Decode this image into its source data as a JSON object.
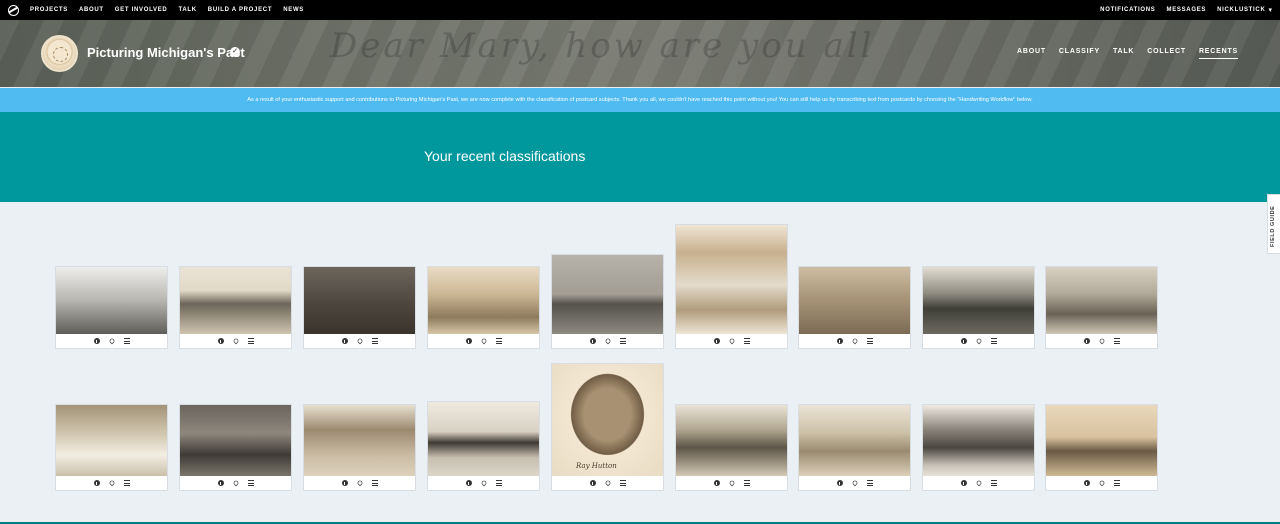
{
  "topnav": {
    "links": [
      "PROJECTS",
      "ABOUT",
      "GET INVOLVED",
      "TALK",
      "BUILD A PROJECT",
      "NEWS"
    ],
    "right": [
      "NOTIFICATIONS",
      "MESSAGES",
      "NICKLUSTICK"
    ]
  },
  "project": {
    "title": "Picturing Michigan's Past",
    "nav": [
      "ABOUT",
      "CLASSIFY",
      "TALK",
      "COLLECT",
      "RECENTS"
    ],
    "active_nav": "RECENTS"
  },
  "announcement": "As a result of your enthusiastic support and contributions to Picturing Michigan's Past, we are now complete with the classification of postcard subjects. Thank you all, we couldn't have reached this point without you! You can still help us by transcribing text from postcards by choosing the \"Handwriting Workflow\" below.",
  "page": {
    "heading": "Your recent classifications",
    "field_guide": "FIELD GUIDE"
  },
  "cards": {
    "row1": [
      {
        "subject": "portrait-group-porch",
        "style": "p-bw"
      },
      {
        "subject": "field-plow",
        "style": "p-field"
      },
      {
        "subject": "workers-dark",
        "style": "p-dark"
      },
      {
        "subject": "house-sepia",
        "style": "p-house"
      },
      {
        "subject": "lake-shore",
        "style": "p-lake"
      },
      {
        "subject": "large-house",
        "style": "p-bighouse"
      },
      {
        "subject": "boat-shipwreck",
        "style": "p-sepia"
      },
      {
        "subject": "river-forest",
        "style": "p-river"
      },
      {
        "subject": "parade-street",
        "style": "p-parade"
      }
    ],
    "row2": [
      {
        "subject": "dining-hall",
        "style": "p-dining"
      },
      {
        "subject": "train-wreck",
        "style": "p-wreck"
      },
      {
        "subject": "main-street",
        "style": "p-street"
      },
      {
        "subject": "barn-building",
        "style": "p-barn"
      },
      {
        "subject": "portrait-boy",
        "style": "p-portrait",
        "caption": "Ray Hutton"
      },
      {
        "subject": "group-outdoors",
        "style": "p-group"
      },
      {
        "subject": "dirt-road",
        "style": "p-road"
      },
      {
        "subject": "storefront",
        "style": "p-shop"
      },
      {
        "subject": "seated-man",
        "style": "p-man"
      }
    ]
  }
}
